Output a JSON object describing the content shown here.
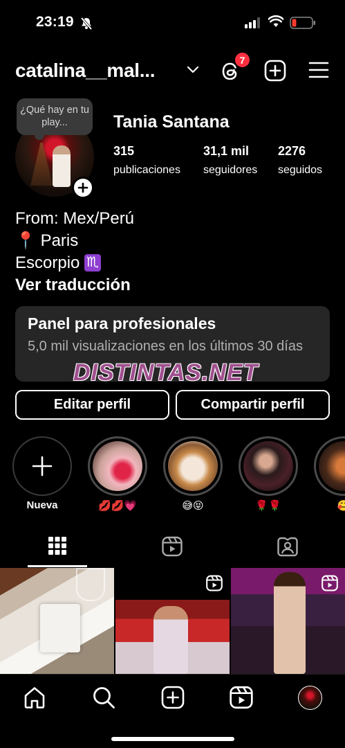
{
  "status_bar": {
    "time": "23:19"
  },
  "header": {
    "username": "catalina__mal...",
    "notification_count": "7"
  },
  "profile": {
    "note": "¿Qué hay en tu play...",
    "display_name": "Tania Santana",
    "stats": [
      {
        "value": "315",
        "label": "publicaciones"
      },
      {
        "value": "31,1 mil",
        "label": "seguidores"
      },
      {
        "value": "2276",
        "label": "seguidos"
      }
    ],
    "bio": {
      "line1": "From: Mex/Perú",
      "line2_emoji": "📍",
      "line2_text": "Paris",
      "line3_text": "Escorpio",
      "line3_symbol": "♏",
      "translate_link": "Ver traducción"
    }
  },
  "pro_panel": {
    "title": "Panel para profesionales",
    "subtitle": "5,0 mil visualizaciones en los últimos 30 días"
  },
  "watermark": "DISTINTAS.NET",
  "buttons": {
    "edit": "Editar perfil",
    "share": "Compartir perfil"
  },
  "highlights": [
    {
      "label": "Nueva"
    },
    {
      "label": "💋💋💗"
    },
    {
      "label": "😅😝"
    },
    {
      "label": "🌹🌹"
    },
    {
      "label": "🥰"
    }
  ],
  "tabs": [
    "grid-tab",
    "reels-tab",
    "tagged-tab"
  ],
  "active_tab": "grid-tab",
  "colors": {
    "background": "#000000",
    "badge": "#ff2f40",
    "panel": "#262626",
    "watermark": "#963c82"
  }
}
